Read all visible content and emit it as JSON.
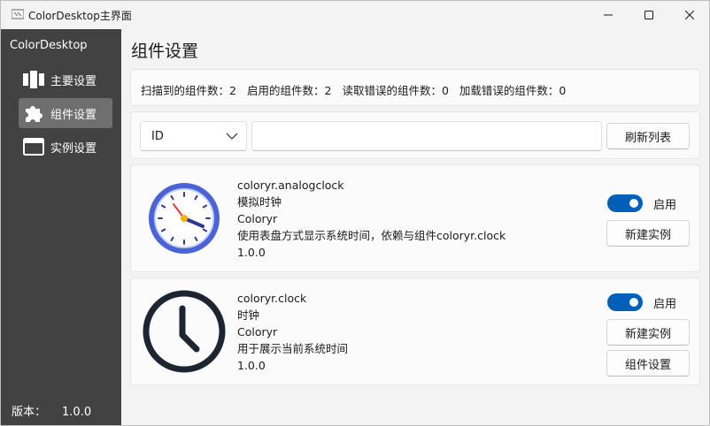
{
  "window": {
    "title": "ColorDesktop主界面"
  },
  "sidebar": {
    "brand": "ColorDesktop",
    "items": [
      {
        "label": "主要设置",
        "icon": "columns-icon",
        "active": false
      },
      {
        "label": "组件设置",
        "icon": "puzzle-icon",
        "active": true
      },
      {
        "label": "实例设置",
        "icon": "window-icon",
        "active": false
      }
    ],
    "version_label": "版本：",
    "version_value": "1.0.0"
  },
  "main": {
    "title": "组件设置",
    "stats": {
      "scanned": "扫描到的组件数：2",
      "enabled": "启用的组件数：2",
      "read_errors": "读取错误的组件数：0",
      "load_errors": "加载错误的组件数：0"
    },
    "filter": {
      "select_value": "ID",
      "input_value": "",
      "refresh_label": "刷新列表"
    },
    "components": [
      {
        "id": "coloryr.analogclock",
        "name": "模拟时钟",
        "author": "Coloryr",
        "description": "使用表盘方式显示系统时间，依赖与组件coloryr.clock",
        "version": "1.0.0",
        "icon": "analog-clock-icon",
        "toggle_label": "启用",
        "enabled": true,
        "new_instance_label": "新建实例"
      },
      {
        "id": "coloryr.clock",
        "name": "时钟",
        "author": "Coloryr",
        "description": "用于展示当前系统时间",
        "version": "1.0.0",
        "icon": "clock-icon",
        "toggle_label": "启用",
        "enabled": true,
        "new_instance_label": "新建实例",
        "settings_label": "组件设置"
      }
    ]
  },
  "colors": {
    "sidebar_bg": "#424242",
    "sidebar_active": "#6f6f6f",
    "accent": "#005fb8",
    "content_bg": "#f3f3f3",
    "card_bg": "#fbfbfb"
  }
}
